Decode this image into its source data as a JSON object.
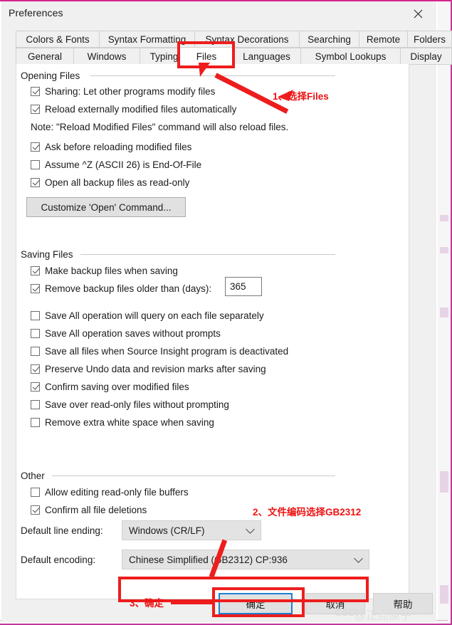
{
  "window": {
    "title": "Preferences",
    "close_icon": "close-icon"
  },
  "tabs": {
    "row1": [
      {
        "label": "Colors & Fonts",
        "selected": false
      },
      {
        "label": "Syntax Formatting",
        "selected": false
      },
      {
        "label": "Syntax Decorations",
        "selected": false
      },
      {
        "label": "Searching",
        "selected": false
      },
      {
        "label": "Remote",
        "selected": false
      },
      {
        "label": "Folders",
        "selected": false
      }
    ],
    "row2": [
      {
        "label": "General",
        "selected": false
      },
      {
        "label": "Windows",
        "selected": false
      },
      {
        "label": "Typing",
        "selected": false
      },
      {
        "label": "Files",
        "selected": true
      },
      {
        "label": "Languages",
        "selected": false
      },
      {
        "label": "Symbol Lookups",
        "selected": false
      },
      {
        "label": "Display",
        "selected": false
      }
    ]
  },
  "groups": {
    "opening": {
      "title": "Opening Files",
      "checkboxes": [
        {
          "label": "Sharing: Let other programs modify files",
          "checked": true
        },
        {
          "label": "Reload externally modified files automatically",
          "checked": true
        },
        {
          "label": "Ask before reloading modified files",
          "checked": true
        },
        {
          "label": "Assume ^Z (ASCII 26) is End-Of-File",
          "checked": false
        },
        {
          "label": "Open all backup files as read-only",
          "checked": true
        }
      ],
      "note": "Note: \"Reload Modified Files\" command will also reload files.",
      "button": "Customize 'Open' Command..."
    },
    "saving": {
      "title": "Saving Files",
      "checkboxes": [
        {
          "label": "Make backup files when saving",
          "checked": true
        },
        {
          "label": "Remove backup files older than (days):",
          "checked": true
        },
        {
          "label": "Save All operation will query on each file separately",
          "checked": false
        },
        {
          "label": "Save All operation saves without prompts",
          "checked": false
        },
        {
          "label": "Save all files when Source Insight program is deactivated",
          "checked": false
        },
        {
          "label": "Preserve Undo data and revision marks after saving",
          "checked": true
        },
        {
          "label": "Confirm saving over modified files",
          "checked": true
        },
        {
          "label": "Save over read-only files without prompting",
          "checked": false
        },
        {
          "label": "Remove extra white space when saving",
          "checked": false
        }
      ],
      "backup_days_value": "365"
    },
    "other": {
      "title": "Other",
      "checkboxes": [
        {
          "label": "Allow editing read-only file buffers",
          "checked": false
        },
        {
          "label": "Confirm all file deletions",
          "checked": true
        }
      ],
      "line_ending_label": "Default line ending:",
      "line_ending_value": "Windows (CR/LF)",
      "encoding_label": "Default encoding:",
      "encoding_value": "Chinese Simplified (GB2312)  CP:936"
    }
  },
  "footer": {
    "ok_label": "确定",
    "cancel_label": "取消",
    "help_label": "帮助"
  },
  "annotations": {
    "step1": "1、选择Files",
    "step2": "2、文件编码选择GB2312",
    "step3": "3、确定",
    "color": "#ee1111"
  },
  "watermark": {
    "text_en": "CSDN",
    "text_cn": "@正点原子"
  }
}
